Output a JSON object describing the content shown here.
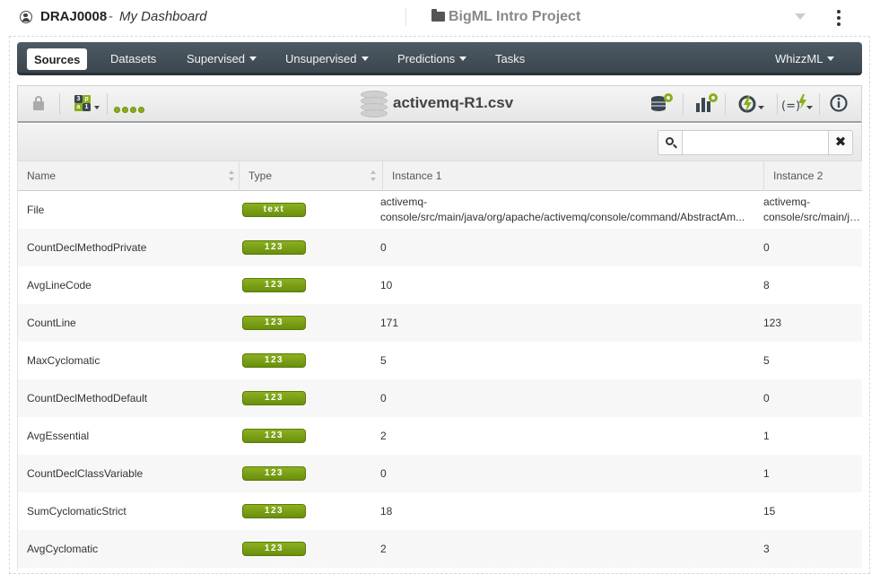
{
  "header": {
    "username": "DRAJ0008",
    "separator": " - ",
    "dashboard_title": "My Dashboard",
    "project_name": "BigML Intro Project"
  },
  "nav": {
    "items": [
      {
        "label": "Sources",
        "active": true,
        "dropdown": false
      },
      {
        "label": "Datasets",
        "active": false,
        "dropdown": false
      },
      {
        "label": "Supervised",
        "active": false,
        "dropdown": true
      },
      {
        "label": "Unsupervised",
        "active": false,
        "dropdown": true
      },
      {
        "label": "Predictions",
        "active": false,
        "dropdown": true
      },
      {
        "label": "Tasks",
        "active": false,
        "dropdown": false
      }
    ],
    "right_item": {
      "label": "WhizzML",
      "dropdown": true
    }
  },
  "toolbar": {
    "source_name": "activemq-R1.csv",
    "icons": [
      "lock-icon",
      "field-types-icon",
      "progress-dots-icon",
      "database-icon",
      "configure-dataset-icon",
      "configure-model-icon",
      "one-click-model-icon",
      "formula-icon",
      "info-icon"
    ],
    "colors": {
      "progress": "#8aae1a",
      "badge": "#7a9e15"
    }
  },
  "search": {
    "value": "",
    "placeholder": ""
  },
  "table": {
    "columns": [
      "Name",
      "Type",
      "Instance 1",
      "Instance 2"
    ],
    "rows": [
      {
        "name": "File",
        "type": "text",
        "inst1": [
          "activemq-",
          "console/src/main/java/org/apache/activemq/console/command/AbstractAm..."
        ],
        "inst2": [
          "activemq-",
          "console/src/main/java/org/apache/activemq/console/command/AbstractAm..."
        ]
      },
      {
        "name": "CountDeclMethodPrivate",
        "type": "123",
        "inst1": "0",
        "inst2": "0"
      },
      {
        "name": "AvgLineCode",
        "type": "123",
        "inst1": "10",
        "inst2": "8"
      },
      {
        "name": "CountLine",
        "type": "123",
        "inst1": "171",
        "inst2": "123"
      },
      {
        "name": "MaxCyclomatic",
        "type": "123",
        "inst1": "5",
        "inst2": "5"
      },
      {
        "name": "CountDeclMethodDefault",
        "type": "123",
        "inst1": "0",
        "inst2": "0"
      },
      {
        "name": "AvgEssential",
        "type": "123",
        "inst1": "2",
        "inst2": "1"
      },
      {
        "name": "CountDeclClassVariable",
        "type": "123",
        "inst1": "0",
        "inst2": "1"
      },
      {
        "name": "SumCyclomaticStrict",
        "type": "123",
        "inst1": "18",
        "inst2": "15"
      },
      {
        "name": "AvgCyclomatic",
        "type": "123",
        "inst1": "2",
        "inst2": "3"
      }
    ]
  }
}
